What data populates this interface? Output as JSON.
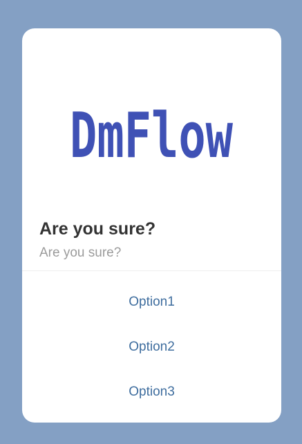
{
  "dialog": {
    "logo_text": "DmFlow",
    "logo_color": "#3f51b5",
    "title": "Are you sure?",
    "subtitle": "Are you sure?",
    "options": [
      {
        "label": "Option1"
      },
      {
        "label": "Option2"
      },
      {
        "label": "Option3"
      }
    ]
  },
  "colors": {
    "backdrop": "#84a0c4",
    "dialog_background": "#ffffff",
    "title": "#333333",
    "subtitle": "#9b9b9b",
    "option_text": "#3e6d9e"
  }
}
